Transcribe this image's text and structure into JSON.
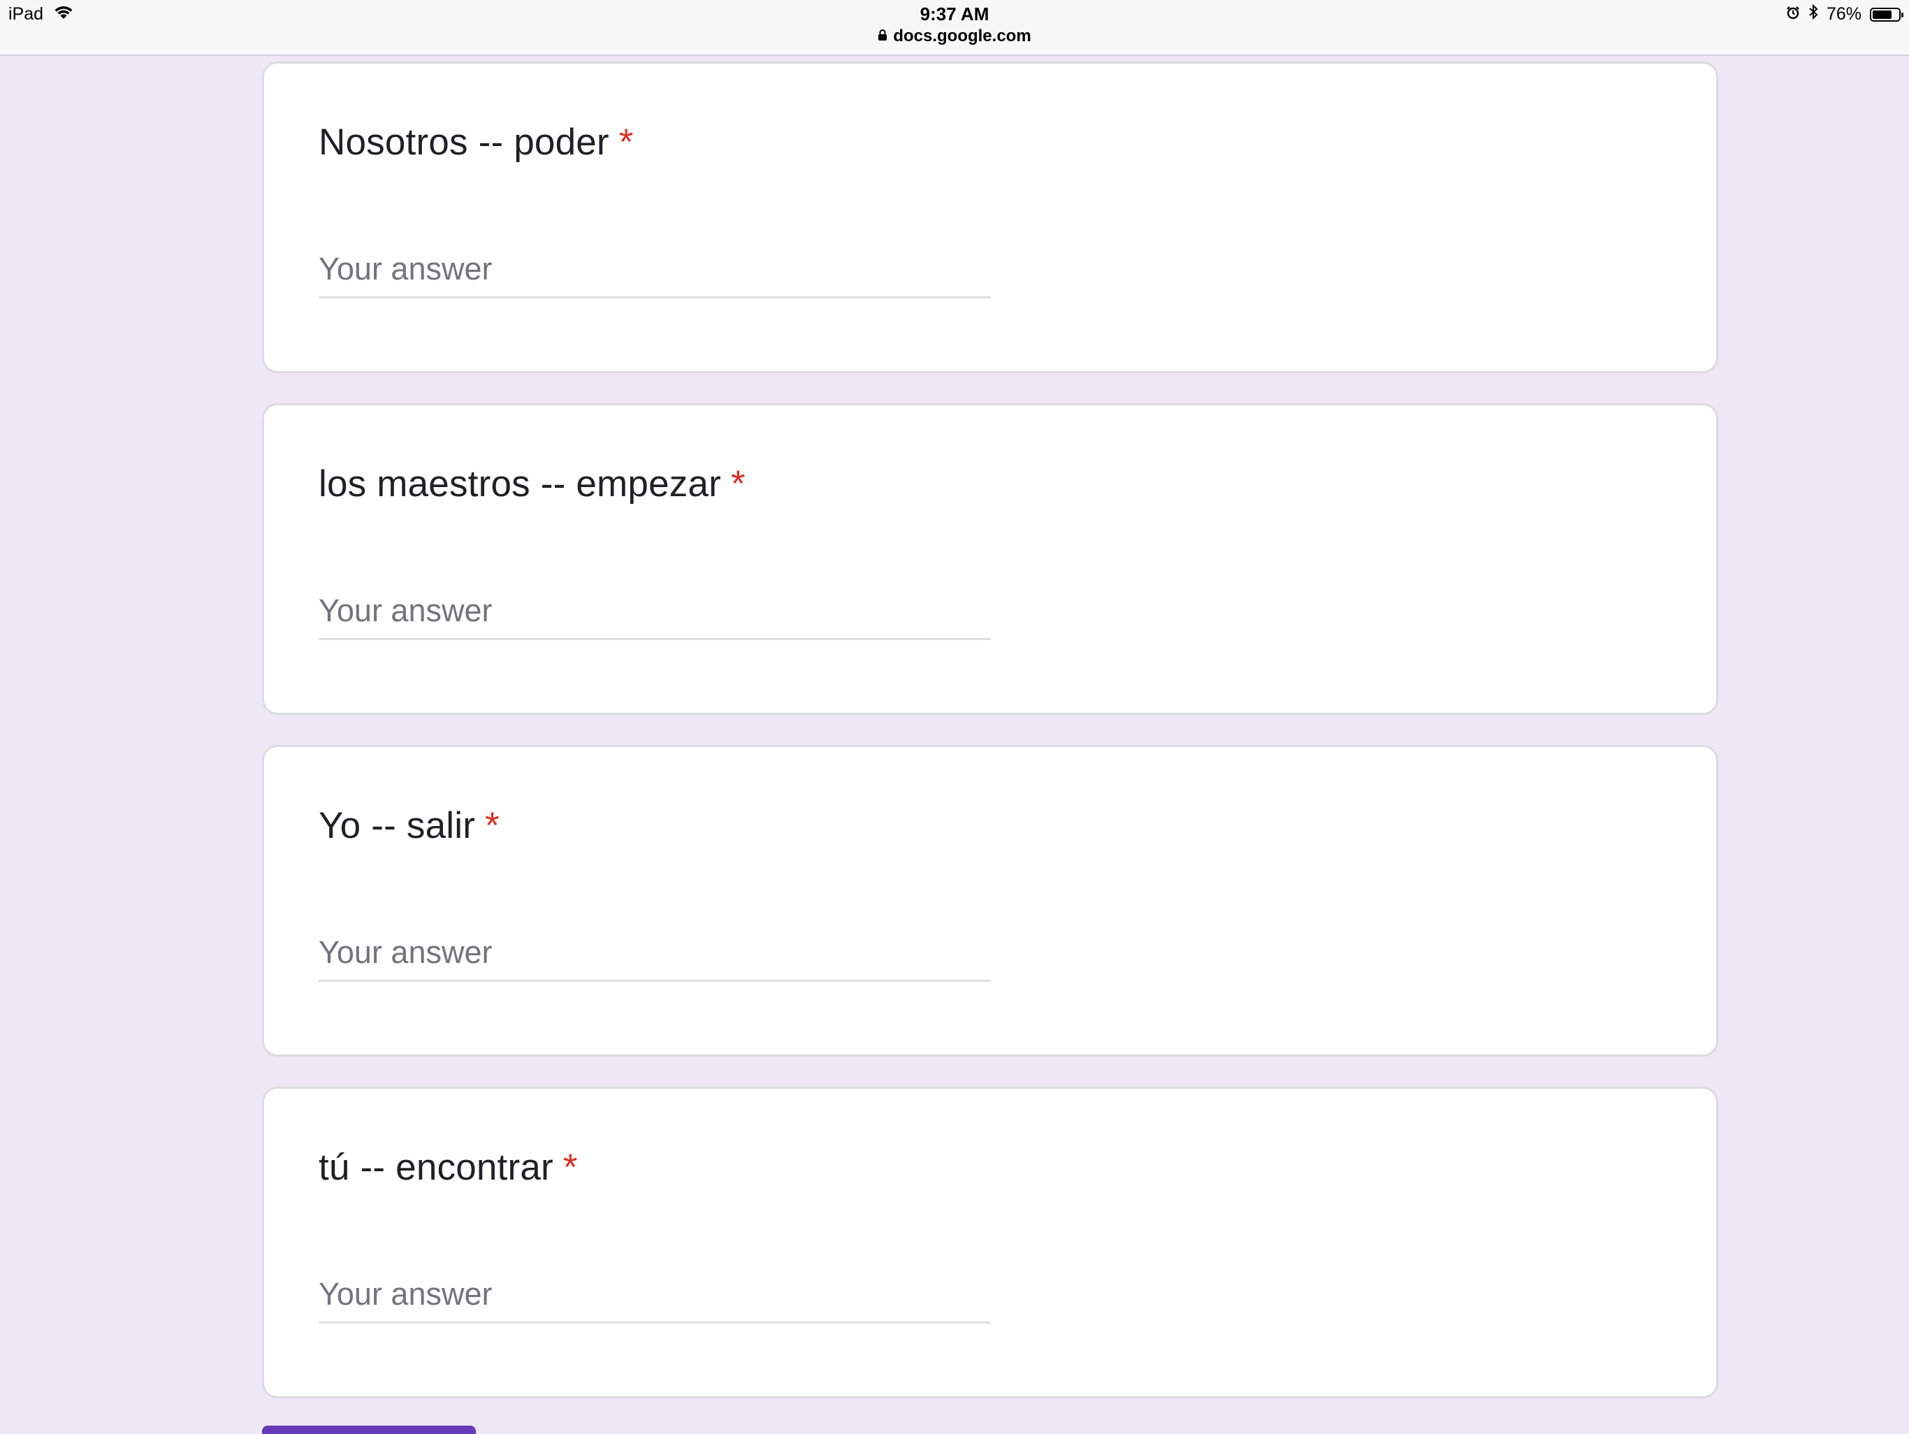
{
  "status_bar": {
    "device": "iPad",
    "time": "9:37 AM",
    "url": "docs.google.com",
    "battery": "76%",
    "battery_level": 0.76,
    "icons": [
      "wifi-icon",
      "lock-icon",
      "alarm-icon",
      "bluetooth-icon",
      "battery-icon"
    ]
  },
  "questions": [
    {
      "title": "Nosotros -- poder",
      "required_mark": "*",
      "placeholder": "Your answer"
    },
    {
      "title": "los maestros -- empezar",
      "required_mark": "*",
      "placeholder": "Your answer"
    },
    {
      "title": "Yo -- salir",
      "required_mark": "*",
      "placeholder": "Your answer"
    },
    {
      "title": "tú -- encontrar",
      "required_mark": "*",
      "placeholder": "Your answer"
    }
  ],
  "colors": {
    "background": "#ede7f6",
    "card": "#ffffff",
    "required": "#d93025",
    "accent": "#673ab7"
  }
}
